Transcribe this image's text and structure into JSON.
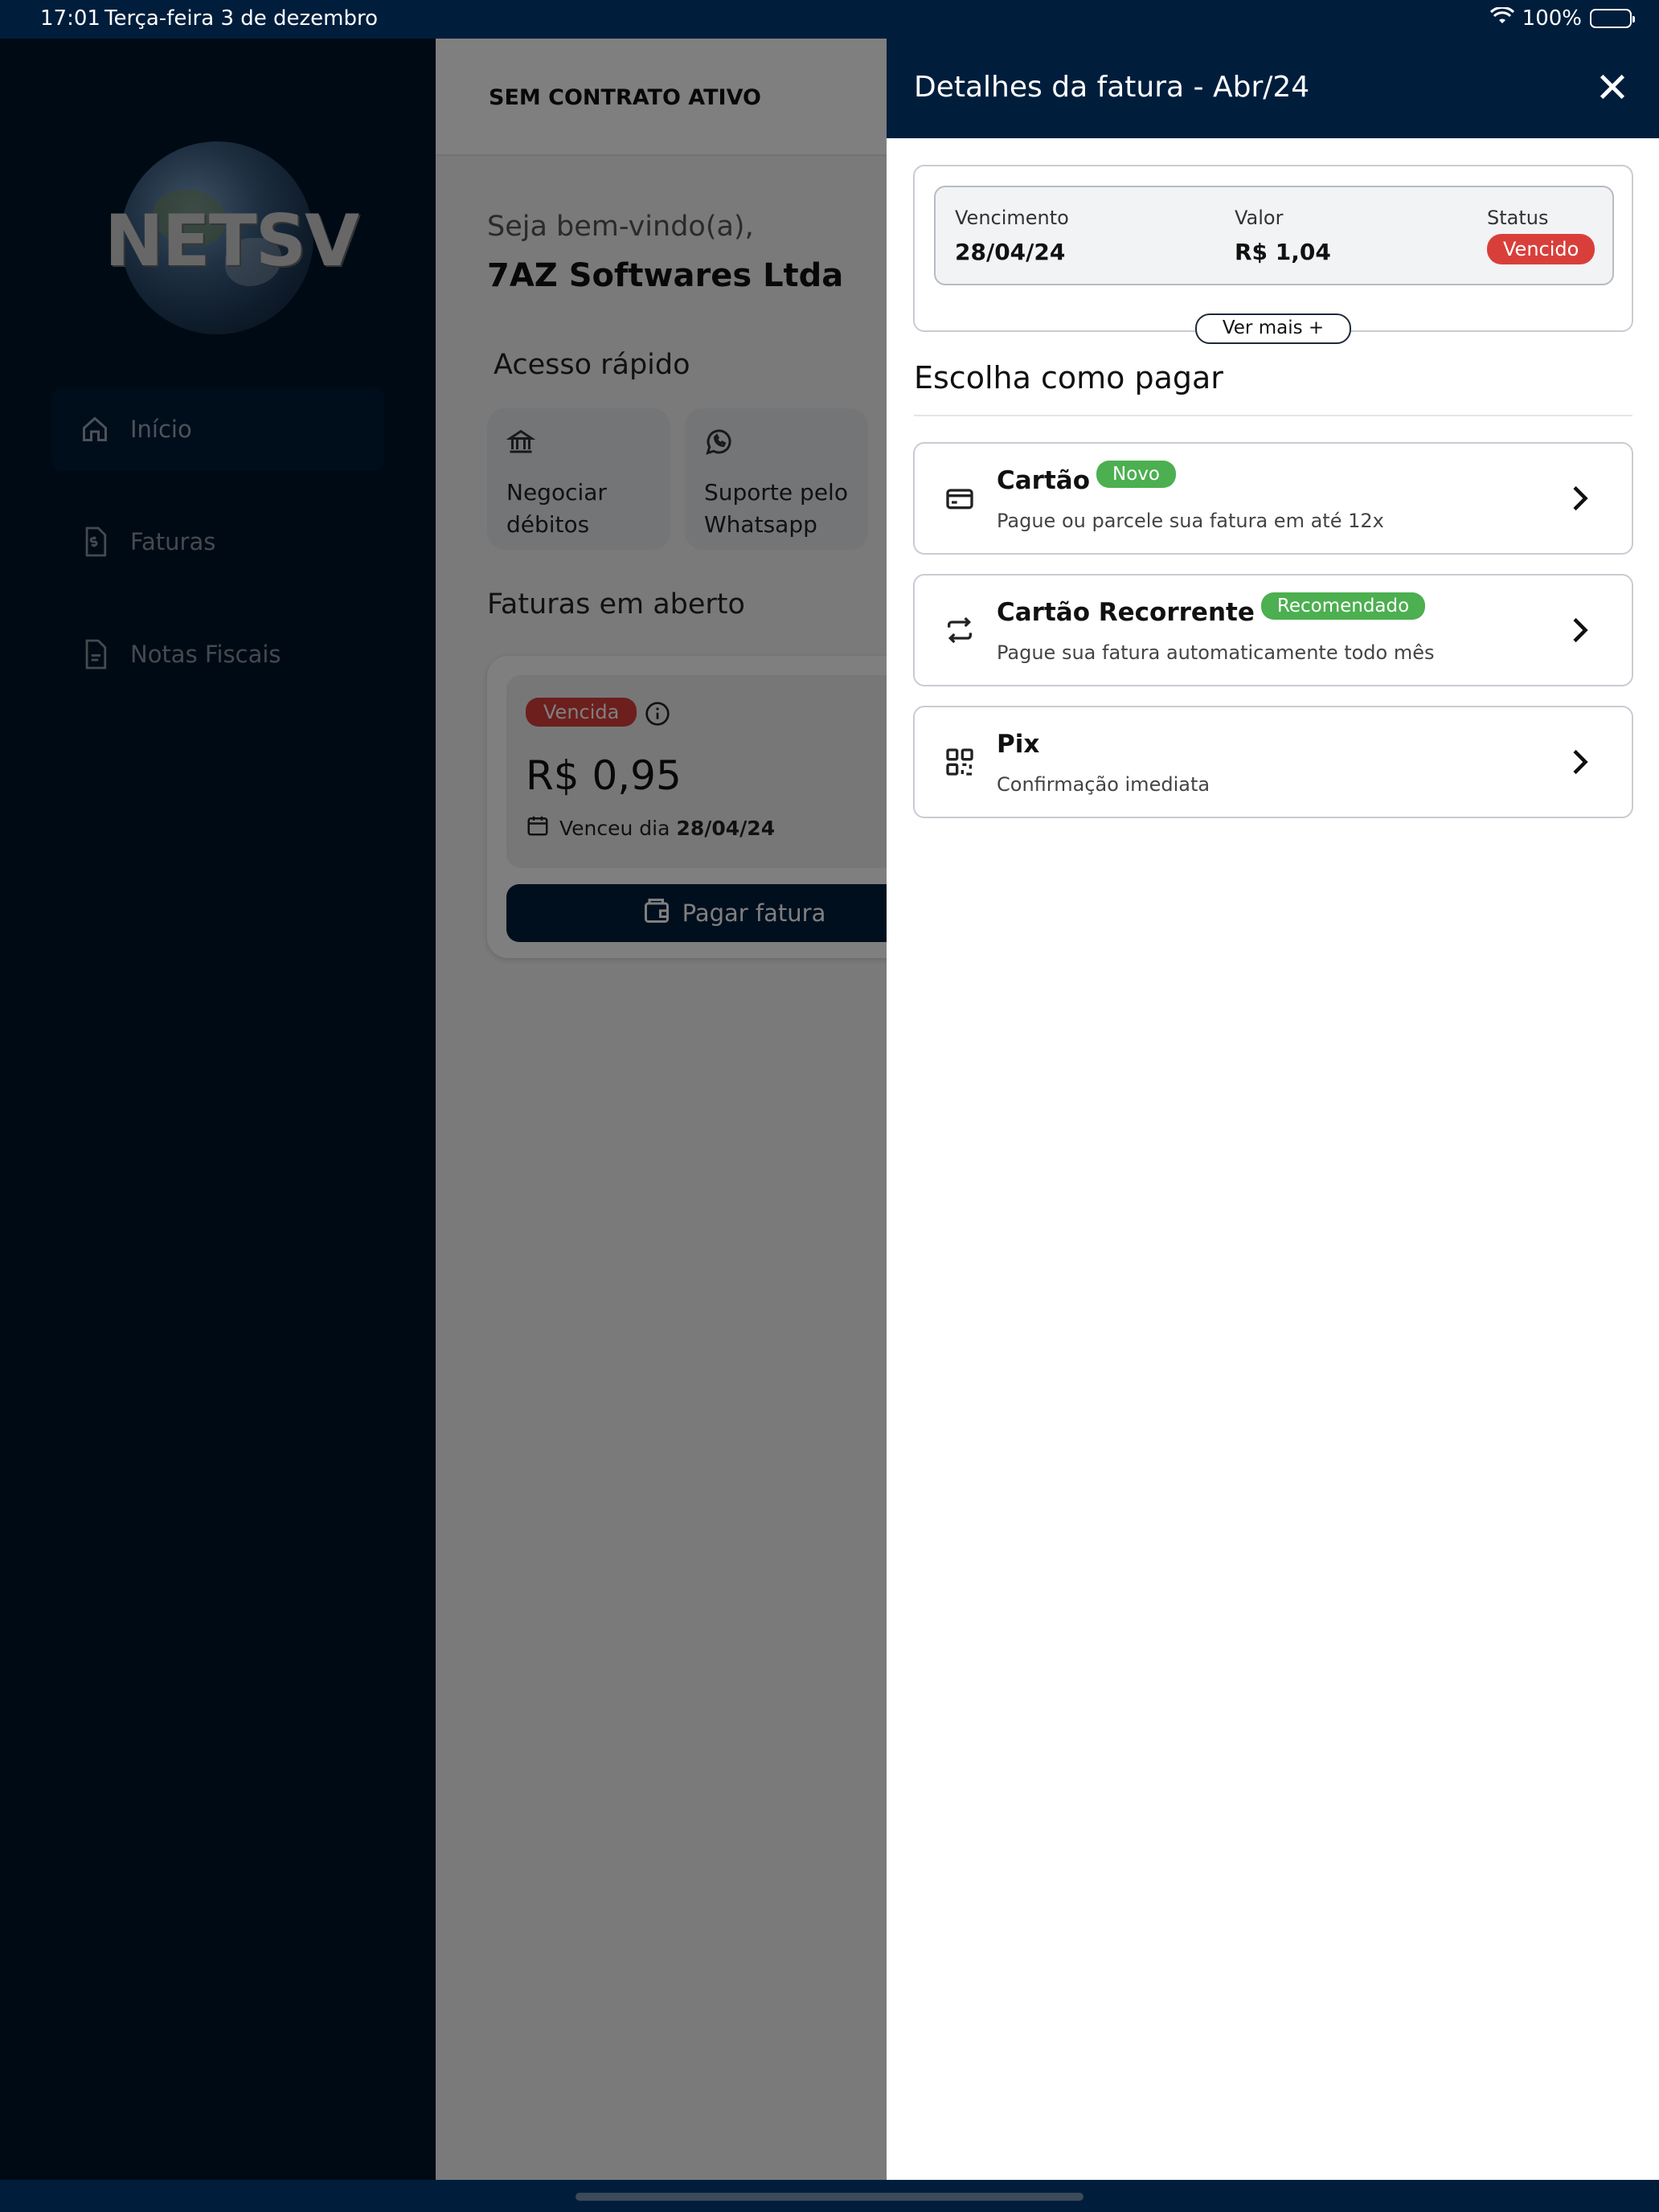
{
  "status_bar": {
    "time": "17:01",
    "date": "Terça-feira 3 de dezembro",
    "battery": "100%"
  },
  "sidebar": {
    "items": [
      {
        "label": "Início",
        "icon": "home-icon",
        "active": true
      },
      {
        "label": "Faturas",
        "icon": "invoice-dollar-icon",
        "active": false
      },
      {
        "label": "Notas Fiscais",
        "icon": "document-icon",
        "active": false
      }
    ]
  },
  "main": {
    "topbar_title": "SEM CONTRATO ATIVO",
    "welcome": "Seja bem-vindo(a),",
    "company": "7AZ Softwares Ltda",
    "quick_access_title": "Acesso rápido",
    "quick_access": [
      {
        "line1": "Negociar",
        "line2": "débitos",
        "icon": "bank-icon"
      },
      {
        "line1": "Suporte pelo",
        "line2": "Whatsapp",
        "icon": "whatsapp-icon"
      }
    ],
    "open_invoices_title": "Faturas em aberto",
    "invoice": {
      "status": "Vencida",
      "amount": "R$ 0,95",
      "due_prefix": "Venceu dia",
      "due_date": "28/04/24",
      "pay_button": "Pagar fatura"
    }
  },
  "panel": {
    "title": "Detalhes da fatura - Abr/24",
    "summary": {
      "due_label": "Vencimento",
      "due_value": "28/04/24",
      "value_label": "Valor",
      "value_value": "R$ 1,04",
      "status_label": "Status",
      "status_value": "Vencido"
    },
    "see_more": "Ver mais +",
    "choose_title": "Escolha como pagar",
    "options": [
      {
        "title": "Cartão",
        "badge": "Novo",
        "subtitle": "Pague ou parcele sua fatura em até 12x",
        "icon": "credit-card-icon"
      },
      {
        "title": "Cartão Recorrente",
        "badge": "Recomendado",
        "subtitle": "Pague sua fatura automaticamente todo mês",
        "icon": "repeat-icon"
      },
      {
        "title": "Pix",
        "badge": "",
        "subtitle": "Confirmação imediata",
        "icon": "qr-code-icon"
      }
    ]
  },
  "colors": {
    "navy": "#001e3c",
    "sidebar_bg": "#001429",
    "danger": "#d93f3a",
    "success": "#4caf50"
  }
}
